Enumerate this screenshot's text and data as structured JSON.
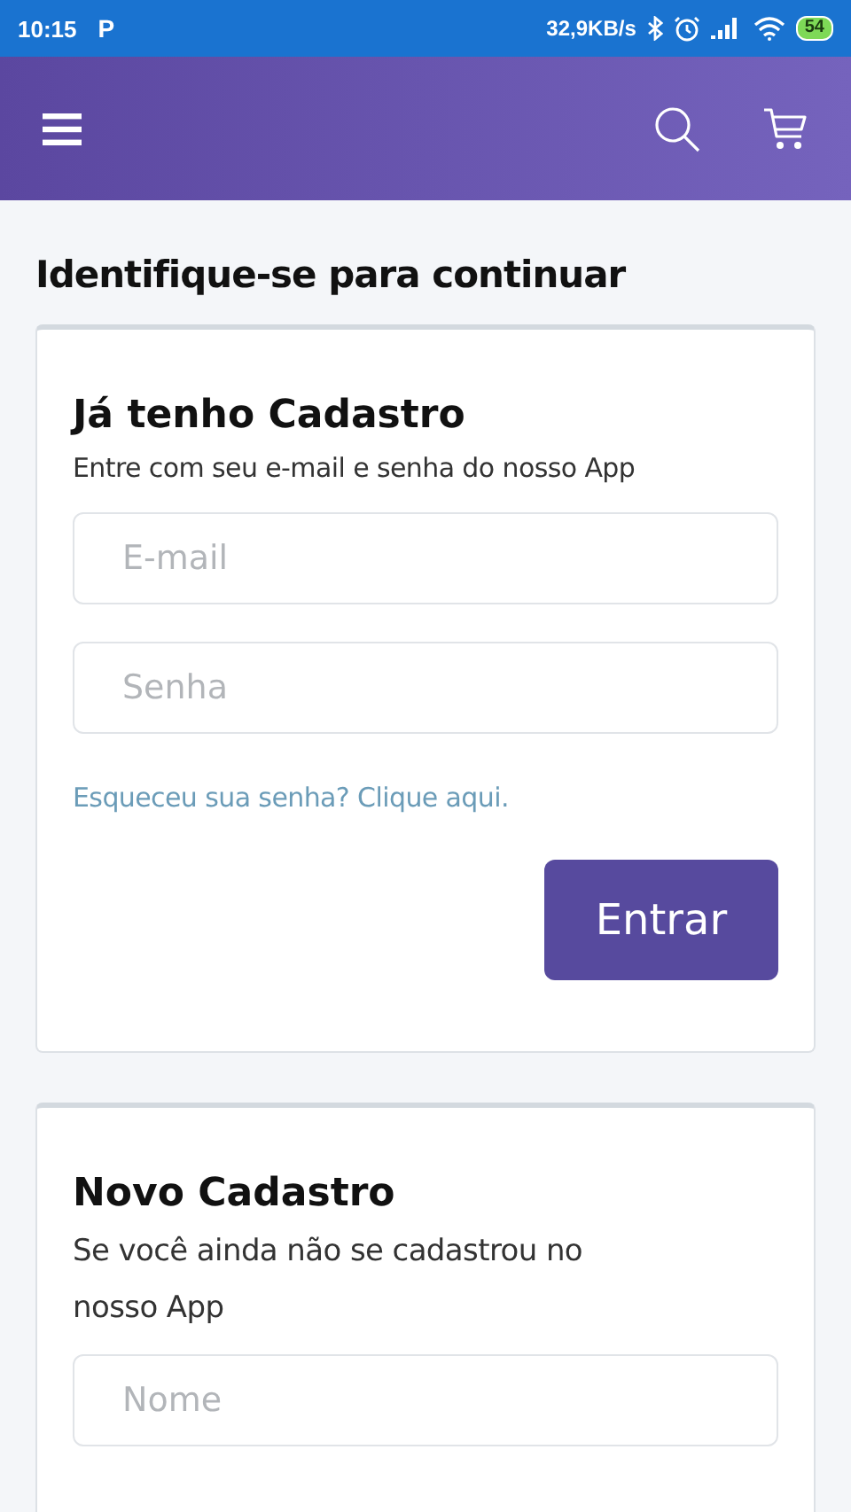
{
  "status_bar": {
    "time": "10:15",
    "app_badge": "P",
    "speed": "32,9KB/s",
    "battery": "54"
  },
  "page_title": "Identifique-se para continuar",
  "login": {
    "title": "Já tenho Cadastro",
    "subtitle": "Entre com seu e-mail e senha do nosso App",
    "fields": [
      {
        "placeholder": "E-mail"
      },
      {
        "placeholder": "Senha"
      }
    ],
    "forgot_link": "Esqueceu sua senha? Clique aqui.",
    "submit": "Entrar"
  },
  "register": {
    "title": "Novo Cadastro",
    "subtitle": "Se você ainda não se cadastrou no nosso App",
    "fields": [
      {
        "placeholder": "Nome"
      }
    ]
  }
}
